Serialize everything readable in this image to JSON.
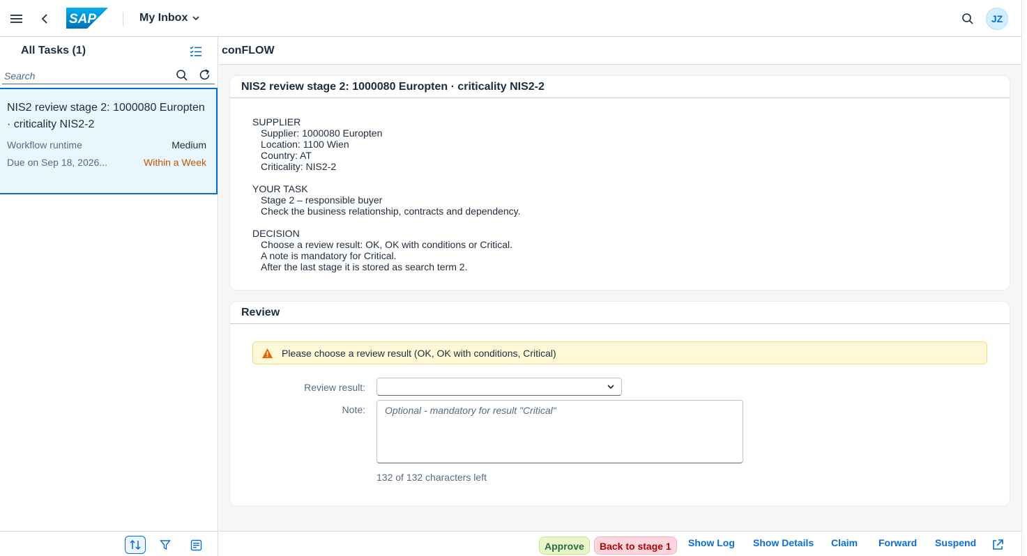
{
  "shell": {
    "title": "My Inbox",
    "logo_text": "SAP",
    "avatar_initials": "JZ",
    "brand_color": "#0a6ed1"
  },
  "list": {
    "title": "All Tasks (1)",
    "search_placeholder": "Search",
    "tasks": [
      {
        "title": "NIS2 review stage 2: 1000080 Europten · criticality NIS2-2",
        "type": "Workflow runtime",
        "priority": "Medium",
        "due": "Due on Sep 18, 2026...",
        "status": "Within a Week",
        "status_color": "#c35500"
      }
    ]
  },
  "detail": {
    "header": "conFLOW",
    "task_card": {
      "title": "NIS2 review stage 2: 1000080 Europten · criticality NIS2-2",
      "supplier_heading": "SUPPLIER",
      "supplier_lines": [
        "Supplier: 1000080 Europten",
        "Location: 1100 Wien",
        "Country: AT",
        "Criticality: NIS2-2"
      ],
      "task_heading": "YOUR TASK",
      "task_lines": [
        "Stage 2 – responsible buyer",
        "Check the business relationship, contracts and dependency."
      ],
      "decision_heading": "DECISION",
      "decision_lines": [
        "Choose a review result: OK, OK with conditions or Critical.",
        "A note is mandatory for Critical.",
        "After the last stage it is stored as search term 2."
      ]
    },
    "review_card": {
      "title": "Review",
      "warning": "Please choose a review result (OK, OK with conditions, Critical)",
      "result_label": "Review result:",
      "result_value": "",
      "note_label": "Note:",
      "note_placeholder": "Optional - mandatory for result \"Critical\"",
      "counter": "132 of 132 characters left"
    }
  },
  "actions": {
    "approve": "Approve",
    "back_to_stage": "Back to stage 1",
    "show_log": "Show Log",
    "show_details": "Show Details",
    "claim": "Claim",
    "forward": "Forward",
    "suspend": "Suspend"
  }
}
